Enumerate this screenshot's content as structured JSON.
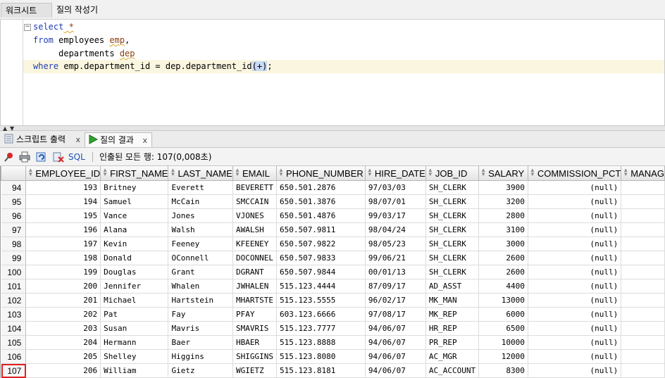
{
  "doc_tabs": {
    "worksheet": "워크시트",
    "query_builder": "질의 작성기"
  },
  "editor": {
    "line1_kw": "select",
    "line1_rest": " *",
    "line2_kw": "from",
    "line2_rest": " employees ",
    "line2_alias": "emp",
    "line2_comma": ",",
    "line3_rest": "     departments ",
    "line3_alias": "dep",
    "line4_kw": "where",
    "line4_rest": " emp.department_id = dep.department_id",
    "line4_paren": "(+)",
    "line4_end": ";"
  },
  "result_tabs": {
    "script_output": "스크립트 출력",
    "query_result": "질의 결과",
    "close": "x"
  },
  "toolbar": {
    "sql_label": "SQL",
    "status": "인출된 모든 행: 107(0,008초)"
  },
  "grid": {
    "columns": [
      "EMPLOYEE_ID",
      "FIRST_NAME",
      "LAST_NAME",
      "EMAIL",
      "PHONE_NUMBER",
      "HIRE_DATE",
      "JOB_ID",
      "SALARY",
      "COMMISSION_PCT",
      "MANAG"
    ],
    "rows": [
      [
        "94",
        "193",
        "Britney",
        "Everett",
        "BEVERETT",
        "650.501.2876",
        "97/03/03",
        "SH_CLERK",
        "3900",
        "(null)"
      ],
      [
        "95",
        "194",
        "Samuel",
        "McCain",
        "SMCCAIN",
        "650.501.3876",
        "98/07/01",
        "SH_CLERK",
        "3200",
        "(null)"
      ],
      [
        "96",
        "195",
        "Vance",
        "Jones",
        "VJONES",
        "650.501.4876",
        "99/03/17",
        "SH_CLERK",
        "2800",
        "(null)"
      ],
      [
        "97",
        "196",
        "Alana",
        "Walsh",
        "AWALSH",
        "650.507.9811",
        "98/04/24",
        "SH_CLERK",
        "3100",
        "(null)"
      ],
      [
        "98",
        "197",
        "Kevin",
        "Feeney",
        "KFEENEY",
        "650.507.9822",
        "98/05/23",
        "SH_CLERK",
        "3000",
        "(null)"
      ],
      [
        "99",
        "198",
        "Donald",
        "OConnell",
        "DOCONNEL",
        "650.507.9833",
        "99/06/21",
        "SH_CLERK",
        "2600",
        "(null)"
      ],
      [
        "100",
        "199",
        "Douglas",
        "Grant",
        "DGRANT",
        "650.507.9844",
        "00/01/13",
        "SH_CLERK",
        "2600",
        "(null)"
      ],
      [
        "101",
        "200",
        "Jennifer",
        "Whalen",
        "JWHALEN",
        "515.123.4444",
        "87/09/17",
        "AD_ASST",
        "4400",
        "(null)"
      ],
      [
        "102",
        "201",
        "Michael",
        "Hartstein",
        "MHARTSTE",
        "515.123.5555",
        "96/02/17",
        "MK_MAN",
        "13000",
        "(null)"
      ],
      [
        "103",
        "202",
        "Pat",
        "Fay",
        "PFAY",
        "603.123.6666",
        "97/08/17",
        "MK_REP",
        "6000",
        "(null)"
      ],
      [
        "104",
        "203",
        "Susan",
        "Mavris",
        "SMAVRIS",
        "515.123.7777",
        "94/06/07",
        "HR_REP",
        "6500",
        "(null)"
      ],
      [
        "105",
        "204",
        "Hermann",
        "Baer",
        "HBAER",
        "515.123.8888",
        "94/06/07",
        "PR_REP",
        "10000",
        "(null)"
      ],
      [
        "106",
        "205",
        "Shelley",
        "Higgins",
        "SHIGGINS",
        "515.123.8080",
        "94/06/07",
        "AC_MGR",
        "12000",
        "(null)"
      ],
      [
        "107",
        "206",
        "William",
        "Gietz",
        "WGIETZ",
        "515.123.8181",
        "94/06/07",
        "AC_ACCOUNT",
        "8300",
        "(null)"
      ]
    ]
  }
}
